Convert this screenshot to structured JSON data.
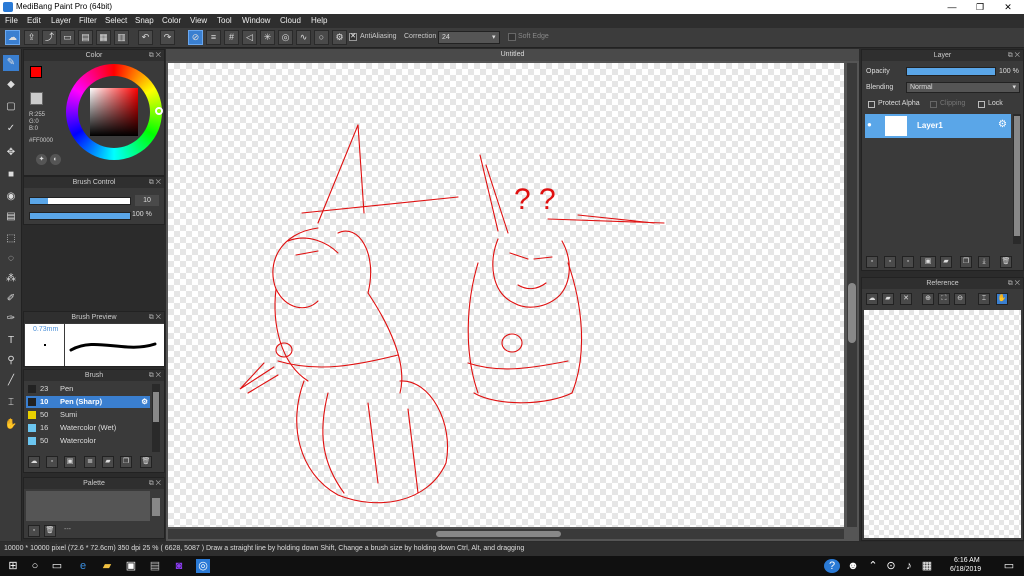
{
  "window": {
    "title": "MediBang Paint Pro (64bit)",
    "minimize": "—",
    "maximize": "❐",
    "close": "✕"
  },
  "menu": [
    "File",
    "Edit",
    "Layer",
    "Filter",
    "Select",
    "Snap",
    "Color",
    "View",
    "Tool",
    "Window",
    "Cloud",
    "Help"
  ],
  "toolbar": {
    "antialiasing_label": "AntiAliasing",
    "antialiasing_checked": "✕",
    "correction_label": "Correction",
    "correction_value": "24",
    "soft_edge_label": "Soft Edge"
  },
  "color_panel": {
    "title": "Color",
    "r": "R:255",
    "g": "G:0",
    "b": "B:0",
    "hex": "#FF0000",
    "primary_color": "#ff0000",
    "secondary_color": "#ffffff"
  },
  "brush_control": {
    "title": "Brush Control",
    "size_value": "10",
    "opacity_value": "100 %"
  },
  "brush_preview": {
    "title": "Brush Preview",
    "size_label": "0.73mm"
  },
  "brush_panel": {
    "title": "Brush",
    "items": [
      {
        "size": "23",
        "name": "Pen",
        "color": "#222222"
      },
      {
        "size": "10",
        "name": "Pen (Sharp)",
        "color": "#222222"
      },
      {
        "size": "50",
        "name": "Sumi",
        "color": "#e8d000"
      },
      {
        "size": "16",
        "name": "Watercolor (Wet)",
        "color": "#6cc6f0"
      },
      {
        "size": "50",
        "name": "Watercolor",
        "color": "#6cc6f0"
      }
    ]
  },
  "palette_panel": {
    "title": "Palette",
    "footer_text": "---"
  },
  "canvas": {
    "tab_title": "Untitled",
    "doodle_text": "? ?"
  },
  "layer_panel": {
    "title": "Layer",
    "opacity_label": "Opacity",
    "opacity_value": "100 %",
    "blending_label": "Blending",
    "blending_value": "Normal",
    "protect_alpha_label": "Protect Alpha",
    "clipping_label": "Clipping",
    "lock_label": "Lock",
    "layers": [
      {
        "name": "Layer1"
      }
    ]
  },
  "reference_panel": {
    "title": "Reference"
  },
  "status": {
    "text": "10000 * 10000 pixel   (72.6 * 72.6cm)   350 dpi   25 %   ( 6628, 5087 )   Draw a straight line by holding down Shift, Change a brush size by holding down Ctrl, Alt, and dragging"
  },
  "taskbar": {
    "time": "6:16 AM",
    "date": "6/18/2019"
  }
}
